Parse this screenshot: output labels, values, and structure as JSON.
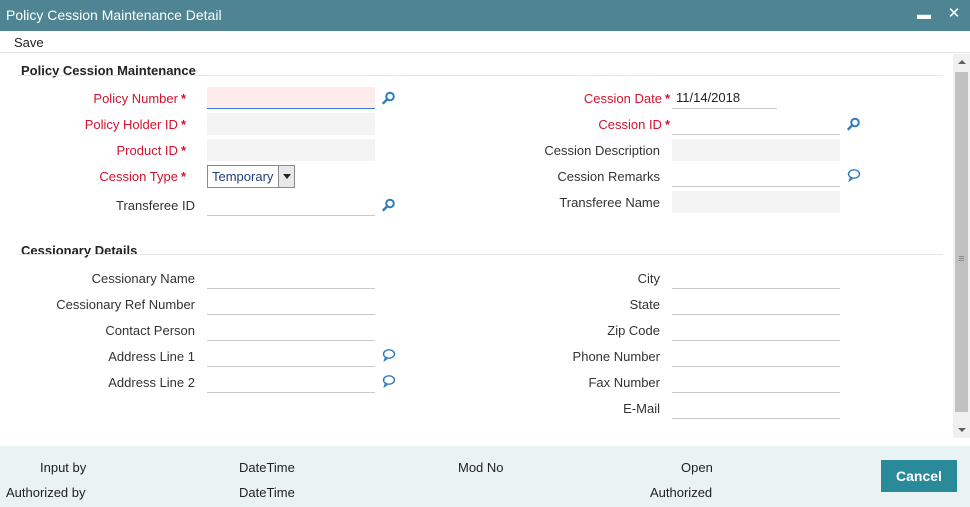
{
  "window": {
    "title": "Policy Cession Maintenance Detail",
    "minimize_glyph": "▬",
    "close_glyph": "✕"
  },
  "toolbar": {
    "save_label": "Save"
  },
  "sections": {
    "maintenance": "Policy Cession Maintenance",
    "cessionary": "Cessionary Details"
  },
  "maintenance": {
    "policy_number": {
      "label": "Policy Number",
      "value": ""
    },
    "policy_holder_id": {
      "label": "Policy Holder ID",
      "value": ""
    },
    "product_id": {
      "label": "Product ID",
      "value": ""
    },
    "cession_type": {
      "label": "Cession Type",
      "value": "Temporary"
    },
    "transferee_id": {
      "label": "Transferee ID",
      "value": ""
    },
    "cession_date": {
      "label": "Cession Date",
      "value": "11/14/2018"
    },
    "cession_id": {
      "label": "Cession ID",
      "value": ""
    },
    "cession_description": {
      "label": "Cession Description",
      "value": ""
    },
    "cession_remarks": {
      "label": "Cession Remarks",
      "value": ""
    },
    "transferee_name": {
      "label": "Transferee Name",
      "value": ""
    }
  },
  "cessionary": {
    "name": {
      "label": "Cessionary Name",
      "value": ""
    },
    "ref_number": {
      "label": "Cessionary Ref Number",
      "value": ""
    },
    "contact_person": {
      "label": "Contact Person",
      "value": ""
    },
    "address_line_1": {
      "label": "Address Line 1",
      "value": ""
    },
    "address_line_2": {
      "label": "Address Line 2",
      "value": ""
    },
    "city": {
      "label": "City",
      "value": ""
    },
    "state": {
      "label": "State",
      "value": ""
    },
    "zip_code": {
      "label": "Zip Code",
      "value": ""
    },
    "phone_number": {
      "label": "Phone Number",
      "value": ""
    },
    "fax_number": {
      "label": "Fax Number",
      "value": ""
    },
    "email": {
      "label": "E-Mail",
      "value": ""
    }
  },
  "footer": {
    "input_by": "Input by",
    "authorized_by": "Authorized by",
    "datetime_1": "DateTime",
    "datetime_2": "DateTime",
    "mod_no": "Mod No",
    "open": "Open",
    "authorized": "Authorized",
    "cancel_label": "Cancel"
  },
  "colors": {
    "titlebar": "#4f8592",
    "required_label": "#d3122f",
    "footer_bg": "#e9f3f3",
    "cancel_button": "#2a8a99",
    "icon_blue": "#2f7bbf"
  },
  "icons": {
    "lookup": "magnifier-icon",
    "comment": "speech-bubble-icon"
  }
}
